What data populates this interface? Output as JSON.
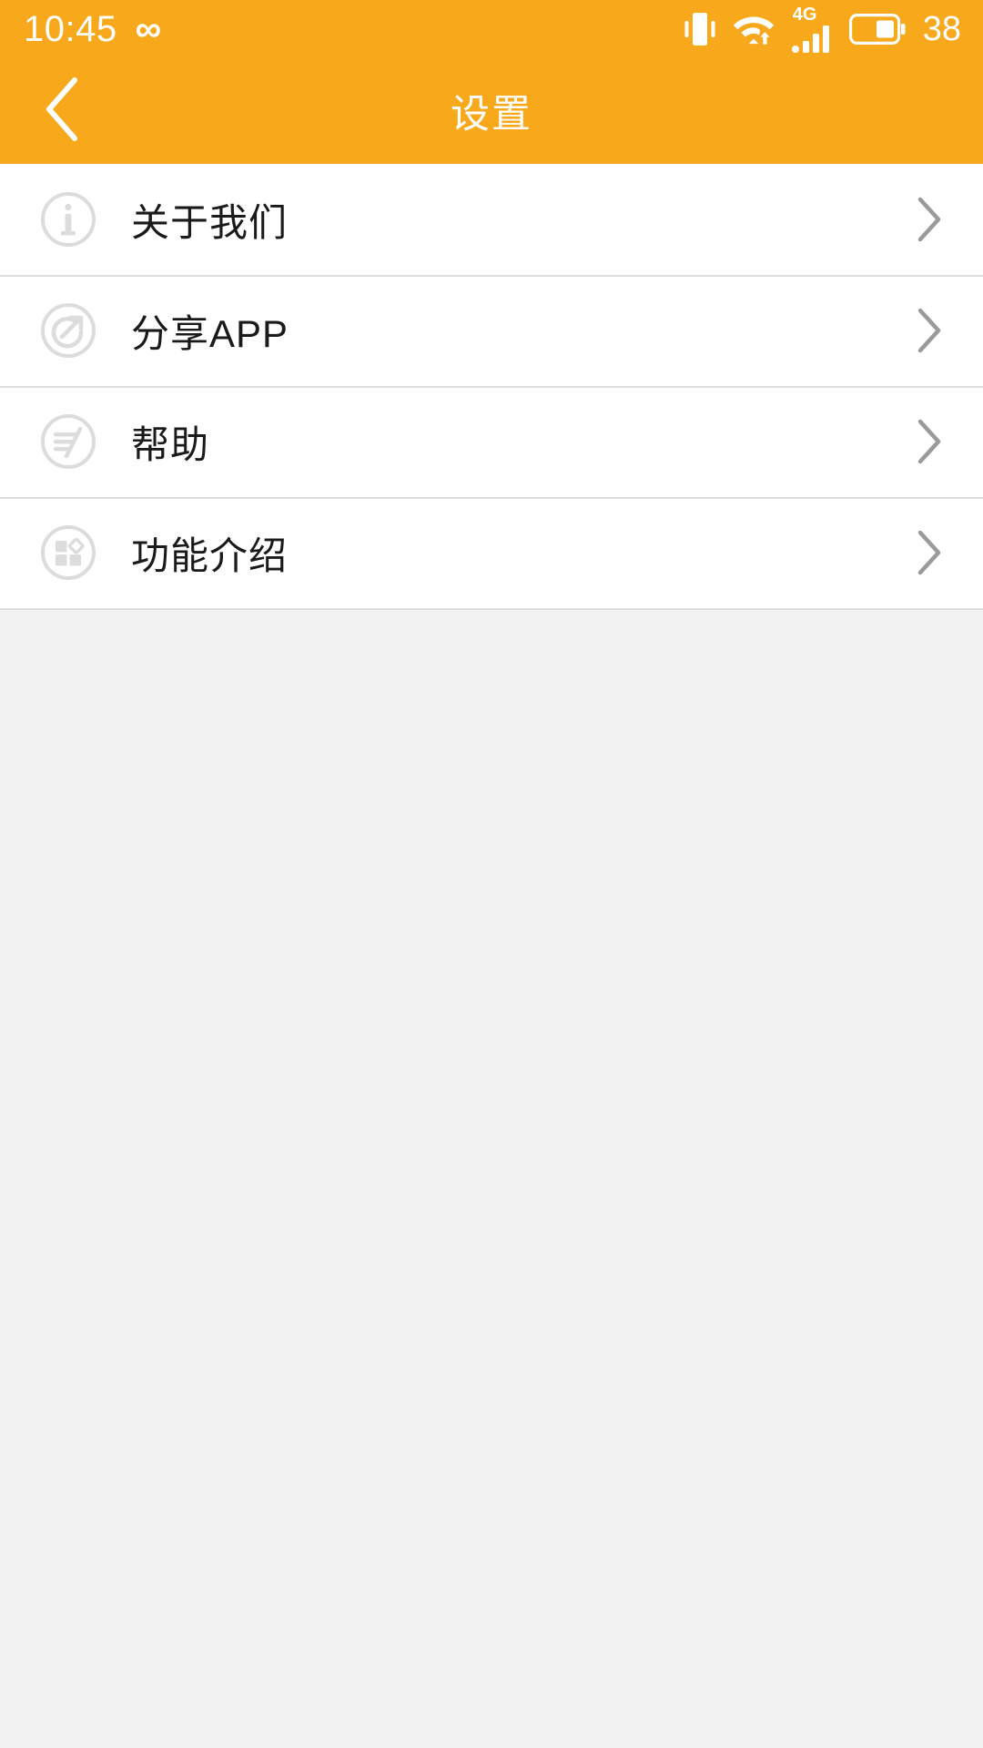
{
  "status_bar": {
    "time": "10:45",
    "infinity_glyph": "∞",
    "icons": [
      "vibrate-icon",
      "wifi-icon",
      "signal-4g-icon",
      "battery-icon"
    ],
    "network_label": "4G",
    "battery_percent": "38",
    "background_color": "#f7a81b",
    "foreground_color": "#ffffff"
  },
  "header": {
    "title": "设置",
    "back_icon": "chevron-left-icon",
    "background_color": "#f7a81b",
    "title_color": "#ffffff"
  },
  "list": {
    "items": [
      {
        "label": "关于我们",
        "icon": "info-circle-icon",
        "chevron": "chevron-right-icon"
      },
      {
        "label": "分享APP",
        "icon": "share-circle-icon",
        "chevron": "chevron-right-icon"
      },
      {
        "label": "帮助",
        "icon": "help-lines-circle-icon",
        "chevron": "chevron-right-icon"
      },
      {
        "label": "功能介绍",
        "icon": "grid-squares-circle-icon",
        "chevron": "chevron-right-icon"
      }
    ],
    "row_background": "#ffffff",
    "divider_color": "#dcdcdc",
    "label_color": "#1a1a1a",
    "icon_color": "#d8d8d8",
    "chevron_color": "#9a9a9a"
  },
  "page": {
    "background_color": "#f2f2f2"
  }
}
